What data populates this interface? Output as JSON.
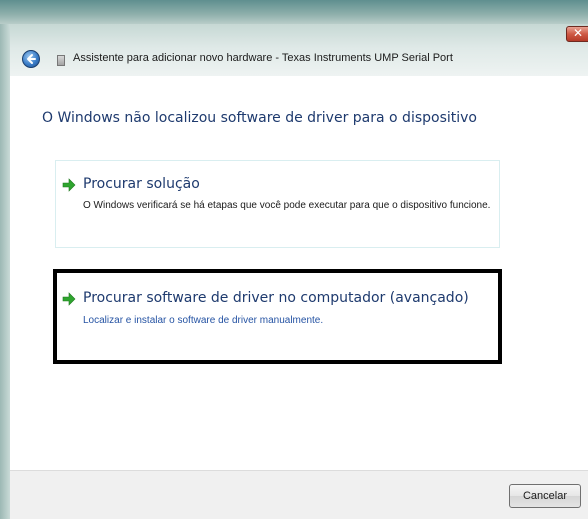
{
  "window": {
    "title": "Assistente para adicionar novo hardware - Texas Instruments UMP Serial Port",
    "close_label": "✕"
  },
  "main": {
    "heading": "O Windows não localizou software de driver para o dispositivo",
    "options": [
      {
        "title": "Procurar solução",
        "description": "O Windows verificará se há etapas que você pode executar para que o dispositivo funcione."
      },
      {
        "title": "Procurar software de driver no computador (avançado)",
        "description": "Localizar e instalar o software de driver manualmente."
      }
    ]
  },
  "footer": {
    "cancel_label": "Cancelar"
  },
  "icons": {
    "back": "back-arrow-icon",
    "hardware": "hardware-icon",
    "option_arrow": "green-arrow-icon",
    "close": "close-icon"
  },
  "colors": {
    "heading_text": "#1e3a6e",
    "option2_description": "#2553a3",
    "option_arrow": "#2fa52f",
    "highlight_border": "#000000"
  }
}
